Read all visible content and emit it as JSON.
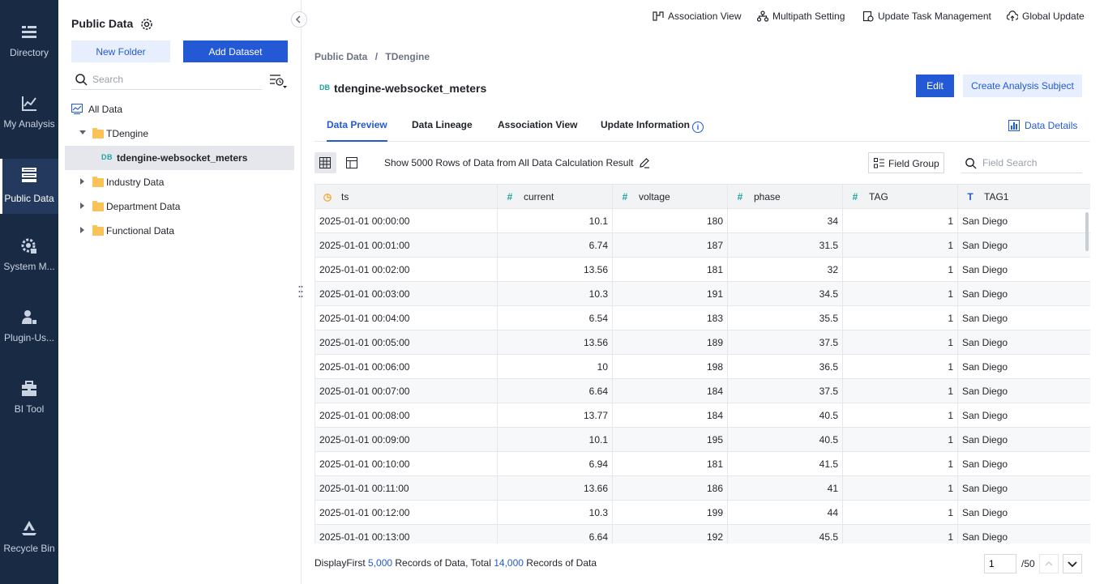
{
  "nav": {
    "items": [
      {
        "label": "Directory",
        "icon": "directory-icon"
      },
      {
        "label": "My Analysis",
        "icon": "chart-icon"
      },
      {
        "label": "Public Data",
        "icon": "database-icon"
      },
      {
        "label": "System M...",
        "icon": "system-gear-icon"
      },
      {
        "label": "Plugin-Us...",
        "icon": "user-plugin-icon"
      },
      {
        "label": "BI Tool",
        "icon": "toolbox-icon"
      },
      {
        "label": "Recycle Bin",
        "icon": "recycle-icon"
      }
    ],
    "active_index": 2
  },
  "panel": {
    "title": "Public Data",
    "new_folder": "New Folder",
    "add_dataset": "Add Dataset",
    "search_placeholder": "Search",
    "tree": {
      "all_data": "All Data",
      "tdengine": "TDengine",
      "dataset": "tdengine-websocket_meters",
      "industry": "Industry Data",
      "department": "Department Data",
      "functional": "Functional Data",
      "db_badge": "DB"
    }
  },
  "topbar": {
    "association_view": "Association View",
    "multipath": "Multipath Setting",
    "update_task": "Update Task Management",
    "global_update": "Global Update"
  },
  "breadcrumb": {
    "root": "Public Data",
    "sep": "/",
    "leaf": "TDengine"
  },
  "header": {
    "badge": "DB",
    "title": "tdengine-websocket_meters",
    "edit": "Edit",
    "create_analysis": "Create Analysis Subject"
  },
  "tabs": {
    "data_preview": "Data Preview",
    "data_lineage": "Data Lineage",
    "association_view": "Association View",
    "update_information": "Update Information",
    "data_details": "Data Details"
  },
  "toolbar": {
    "rows_text": "Show 5000 Rows of Data from All Data Calculation Result",
    "field_group": "Field Group",
    "field_search_placeholder": "Field Search"
  },
  "table": {
    "columns": [
      {
        "name": "ts",
        "type": "time"
      },
      {
        "name": "current",
        "type": "number"
      },
      {
        "name": "voltage",
        "type": "number"
      },
      {
        "name": "phase",
        "type": "number"
      },
      {
        "name": "TAG",
        "type": "number"
      },
      {
        "name": "TAG1",
        "type": "text"
      }
    ],
    "rows": [
      [
        "2025-01-01 00:00:00",
        "10.1",
        "180",
        "34",
        "1",
        "San Diego"
      ],
      [
        "2025-01-01 00:01:00",
        "6.74",
        "187",
        "31.5",
        "1",
        "San Diego"
      ],
      [
        "2025-01-01 00:02:00",
        "13.56",
        "181",
        "32",
        "1",
        "San Diego"
      ],
      [
        "2025-01-01 00:03:00",
        "10.3",
        "191",
        "34.5",
        "1",
        "San Diego"
      ],
      [
        "2025-01-01 00:04:00",
        "6.54",
        "183",
        "35.5",
        "1",
        "San Diego"
      ],
      [
        "2025-01-01 00:05:00",
        "13.56",
        "189",
        "37.5",
        "1",
        "San Diego"
      ],
      [
        "2025-01-01 00:06:00",
        "10",
        "198",
        "36.5",
        "1",
        "San Diego"
      ],
      [
        "2025-01-01 00:07:00",
        "6.64",
        "184",
        "37.5",
        "1",
        "San Diego"
      ],
      [
        "2025-01-01 00:08:00",
        "13.77",
        "184",
        "40.5",
        "1",
        "San Diego"
      ],
      [
        "2025-01-01 00:09:00",
        "10.1",
        "195",
        "40.5",
        "1",
        "San Diego"
      ],
      [
        "2025-01-01 00:10:00",
        "6.94",
        "181",
        "41.5",
        "1",
        "San Diego"
      ],
      [
        "2025-01-01 00:11:00",
        "13.66",
        "186",
        "41",
        "1",
        "San Diego"
      ],
      [
        "2025-01-01 00:12:00",
        "10.3",
        "199",
        "44",
        "1",
        "San Diego"
      ],
      [
        "2025-01-01 00:13:00",
        "6.64",
        "192",
        "45.5",
        "1",
        "San Diego"
      ]
    ]
  },
  "footer": {
    "prefix": "DisplayFirst",
    "shown": "5,000",
    "middle": "Records of Data, Total",
    "total": "14,000",
    "suffix": "Records of Data",
    "page": "1",
    "pages": "/50"
  },
  "colors": {
    "accent": "#2459d6",
    "nav_bg": "#192a45",
    "folder": "#f9c357",
    "db_badge": "#1aa6a0"
  }
}
